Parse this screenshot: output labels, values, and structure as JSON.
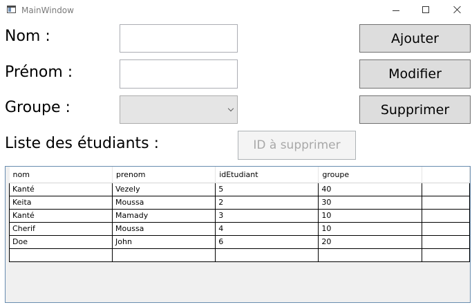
{
  "window": {
    "title": "MainWindow"
  },
  "form": {
    "nom_label": "Nom :",
    "prenom_label": "Prénom :",
    "groupe_label": "Groupe :",
    "liste_label": "Liste des étudiants :",
    "nom_value": "",
    "prenom_value": "",
    "groupe_value": "",
    "id_placeholder": "ID à supprimer"
  },
  "buttons": {
    "add": "Ajouter",
    "edit": "Modifier",
    "delete": "Supprimer"
  },
  "table": {
    "columns": [
      "nom",
      "prenom",
      "idEtudiant",
      "groupe"
    ],
    "rows": [
      [
        "Kanté",
        "Vezely",
        "5",
        "40"
      ],
      [
        "Keita",
        "Moussa",
        "2",
        "30"
      ],
      [
        "Kanté",
        "Mamady",
        "3",
        "10"
      ],
      [
        "Cherif",
        "Moussa",
        "4",
        "10"
      ],
      [
        "Doe",
        "John",
        "6",
        "20"
      ]
    ]
  }
}
